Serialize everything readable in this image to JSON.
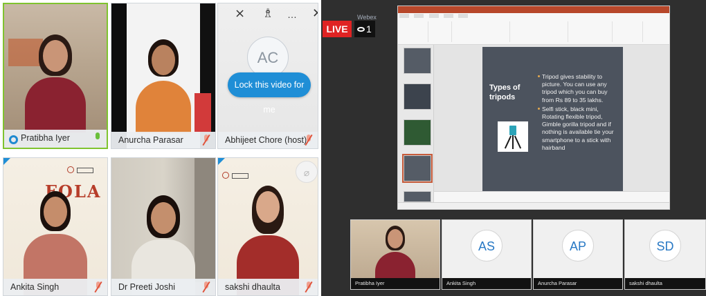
{
  "gallery": {
    "tiles": [
      {
        "name": "Pratibha Iyer",
        "mic": "on"
      },
      {
        "name": "Anurcha Parasar",
        "mic": "muted"
      },
      {
        "name": "Abhijeet Chore (host)",
        "mic": "muted",
        "initials": "AC"
      },
      {
        "name": "Ankita Singh",
        "mic": "muted"
      },
      {
        "name": "Dr Preeti Joshi",
        "mic": "muted"
      },
      {
        "name": "sakshi dhaulta",
        "mic": "muted"
      }
    ],
    "lock_button_label": "Lock this video for me",
    "event_logo_text": "FOLA"
  },
  "meeting": {
    "live_label": "LIVE",
    "viewer_count": "1",
    "app_name": "Webex",
    "slide": {
      "title": "Types of tripods",
      "bullets": [
        "Tripod gives stability to picture. You can use any tripod which you can buy from Rs 89 to 35 lakhs.",
        "Selfi stick, black mini, Rotating flexible tripod, Gimble gorilla tripod and if nothing is available tie your smartphone to a stick with hairband"
      ]
    },
    "participants": [
      {
        "name": "Pratibha Iyer",
        "initials": ""
      },
      {
        "name": "Ankita Singh",
        "initials": "AS"
      },
      {
        "name": "Anurcha Parasar",
        "initials": "AP"
      },
      {
        "name": "sakshi dhaulta",
        "initials": "SD"
      }
    ]
  },
  "colors": {
    "accent_blue": "#1f8ed6",
    "live_red": "#e02323",
    "slide_bg": "#4c535e",
    "muted_red": "#e0533b",
    "active_green": "#7fc32e"
  }
}
